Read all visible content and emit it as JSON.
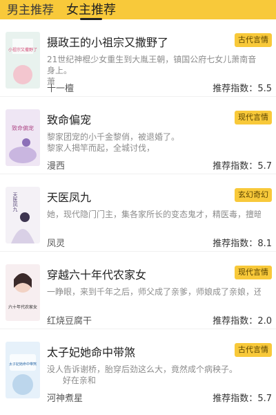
{
  "tabs": [
    {
      "label": "男主推荐",
      "active": false
    },
    {
      "label": "女主推荐",
      "active": true
    }
  ],
  "accent": "#f8c93a",
  "books": [
    {
      "title": "摄政王的小祖宗又撒野了",
      "desc": "21世纪神棍少女重生到大胤王朝，镇国公府七女儿萧南音身上。\n萧",
      "author": "十一檀",
      "score_label": "推荐指数：",
      "score": "5.5",
      "category": "古代言情",
      "cover_text": "小祖宗又撒野了"
    },
    {
      "title": "致命偏宠",
      "desc": "黎家团宠的小千金黎俏，被退婚了。\n黎家人揭竿而起，全城讨伐，",
      "author": "漫西",
      "score_label": "推荐指数：",
      "score": "5.7",
      "category": "现代言情",
      "cover_text": "致命偏宠"
    },
    {
      "title": "天医凤九",
      "desc": "她，现代隐门门主，集各家所长的变态鬼才，精医毒，擅暗杀，世人",
      "author": "凤灵",
      "score_label": "推荐指数：",
      "score": "8.1",
      "category": "玄幻奇幻",
      "cover_text": "天医凤九"
    },
    {
      "title": "穿越六十年代农家女",
      "desc": "一睁眼，来到千年之后，师父成了亲爹，师娘成了亲娘，还附送一枚",
      "author": "红烧豆腐干",
      "score_label": "推荐指数：",
      "score": "2.0",
      "category": "现代言情",
      "cover_text": "六十年代农家女"
    },
    {
      "title": "太子妃她命中带煞",
      "desc": "没人告诉谢桥，胎穿后劲这么大，竟然成个病秧子。\n      好在亲和",
      "author": "河神煮星",
      "score_label": "推荐指数：",
      "score": "5.7",
      "category": "古代言情",
      "cover_text": "太子妃她命中带煞"
    }
  ]
}
